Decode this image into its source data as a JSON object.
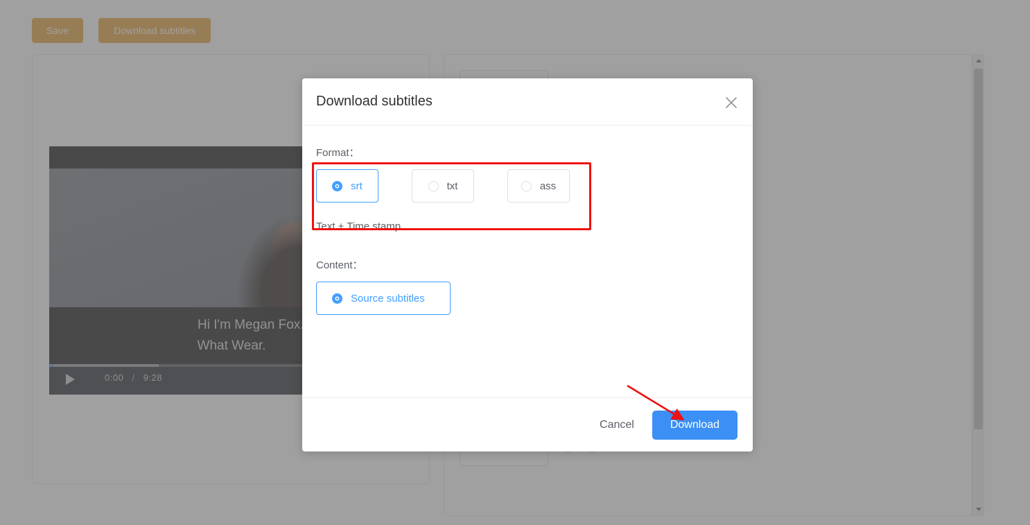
{
  "toolbar": {
    "save_label": "Save",
    "download_subtitles_label": "Download subtitles",
    "button_color": "#e6a23c"
  },
  "player": {
    "subtitle_line_1": "Hi I'm Megan Fox. And I'm he",
    "subtitle_line_2": "What Wear.",
    "current_time": "0:00",
    "time_separator": "/",
    "duration": "9:28",
    "play_icon": "play-icon"
  },
  "editor": {
    "rows": [
      {
        "text": "",
        "add_icon": "plus-circle-icon",
        "remove_icon": "minus-circle-icon"
      },
      {
        "text": "",
        "add_icon": "plus-circle-icon",
        "remove_icon": "minus-circle-icon"
      },
      {
        "text": "",
        "add_icon": "plus-circle-icon",
        "remove_icon": "minus-circle-icon"
      },
      {
        "text": "",
        "add_icon": "plus-circle-icon",
        "remove_icon": "minus-circle-icon"
      }
    ],
    "add_glyph": "⊕",
    "remove_glyph": "⊖",
    "scrollbar": {
      "up_icon": "scroll-up-arrow-icon",
      "down_icon": "scroll-down-arrow-icon"
    }
  },
  "modal": {
    "title": "Download subtitles",
    "close_icon": "close-icon",
    "format_label": "Format：",
    "format_options": [
      {
        "label": "srt",
        "selected": true
      },
      {
        "label": "txt",
        "selected": false
      },
      {
        "label": "ass",
        "selected": false
      }
    ],
    "format_description": "Text + Time stamp",
    "content_label": "Content：",
    "content_options": [
      {
        "label": "Source subtitles",
        "selected": true
      }
    ],
    "cancel_label": "Cancel",
    "download_label": "Download",
    "accent_color": "#409eff",
    "primary_button_color": "#3b8ff5"
  },
  "annotations": {
    "highlight_box_color": "#ee1111",
    "arrow_color": "#ee1111",
    "highlight_target": "format-radio-group",
    "arrow_target": "download-button"
  }
}
